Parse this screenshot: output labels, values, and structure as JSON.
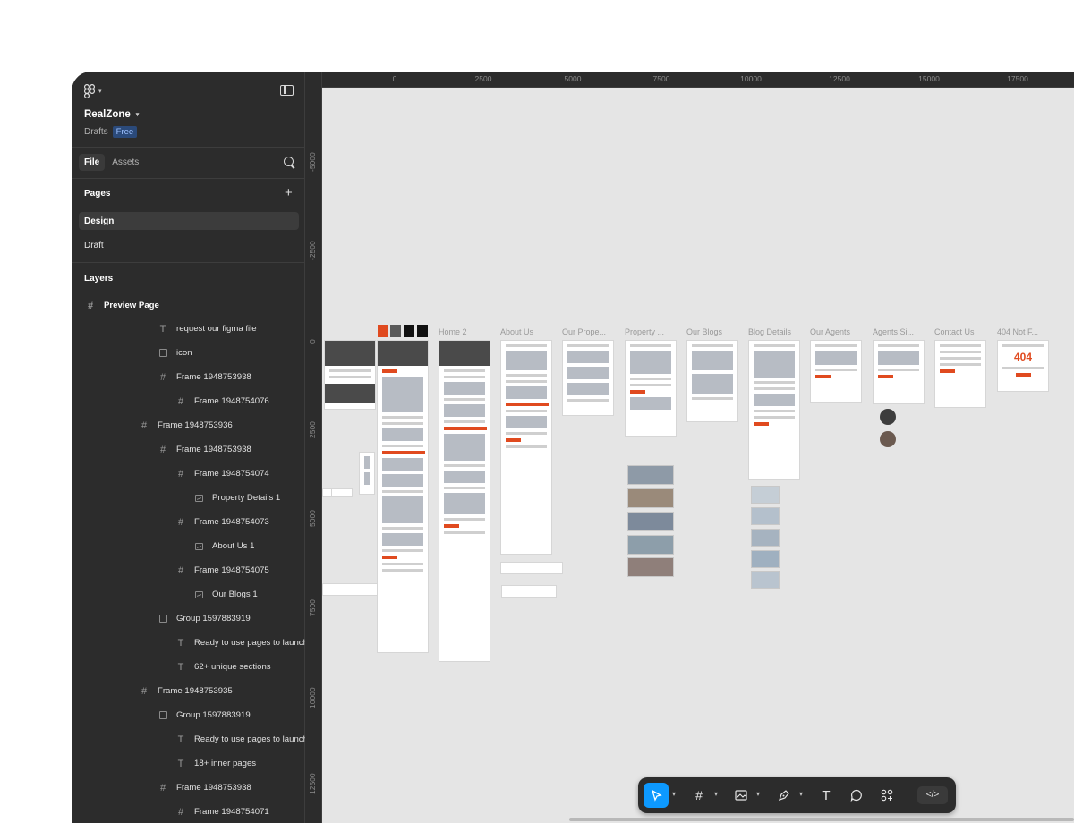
{
  "app": {
    "file_name": "RealZone",
    "location": "Drafts",
    "plan_badge": "Free"
  },
  "sidebar": {
    "tabs": [
      "File",
      "Assets"
    ],
    "pages_title": "Pages",
    "pages": [
      "Design",
      "Draft"
    ],
    "layers_title": "Layers",
    "root_layer": "Preview Page",
    "layers": [
      {
        "name": "request our figma file",
        "type": "text",
        "depth": 4
      },
      {
        "name": "icon",
        "type": "group",
        "depth": 4
      },
      {
        "name": "Frame 1948753938",
        "type": "frame",
        "depth": 4
      },
      {
        "name": "Frame 1948754076",
        "type": "frame",
        "depth": 5
      },
      {
        "name": "Frame 1948753936",
        "type": "frame",
        "depth": 3
      },
      {
        "name": "Frame 1948753938",
        "type": "frame",
        "depth": 4
      },
      {
        "name": "Frame 1948754074",
        "type": "frame",
        "depth": 5
      },
      {
        "name": "Property Details 1",
        "type": "image",
        "depth": 6
      },
      {
        "name": "Frame 1948754073",
        "type": "frame",
        "depth": 5
      },
      {
        "name": "About Us 1",
        "type": "image",
        "depth": 6
      },
      {
        "name": "Frame 1948754075",
        "type": "frame",
        "depth": 5
      },
      {
        "name": "Our Blogs 1",
        "type": "image",
        "depth": 6
      },
      {
        "name": "Group 1597883919",
        "type": "group",
        "depth": 4
      },
      {
        "name": "Ready to use pages to launch",
        "type": "text",
        "depth": 5
      },
      {
        "name": "62+ unique sections",
        "type": "text",
        "depth": 5
      },
      {
        "name": "Frame 1948753935",
        "type": "frame",
        "depth": 3
      },
      {
        "name": "Group 1597883919",
        "type": "group",
        "depth": 4
      },
      {
        "name": "Ready to use pages to launch",
        "type": "text",
        "depth": 5
      },
      {
        "name": "18+ inner pages",
        "type": "text",
        "depth": 5
      },
      {
        "name": "Frame 1948753938",
        "type": "frame",
        "depth": 4
      },
      {
        "name": "Frame 1948754071",
        "type": "frame",
        "depth": 5
      }
    ]
  },
  "canvas": {
    "ruler_top": [
      "0",
      "2500",
      "5000",
      "7500",
      "10000",
      "12500",
      "15000",
      "17500"
    ],
    "ruler_left": [
      "-5000",
      "-2500",
      "0",
      "2500",
      "5000",
      "7500",
      "10000",
      "12500"
    ],
    "frame_titles": [
      "Home 2",
      "About Us",
      "Our Prope...",
      "Property ...",
      "Our Blogs",
      "Blog Details",
      "Our Agents",
      "Agents Si...",
      "Contact Us",
      "404 Not F..."
    ],
    "not_found_text": "404",
    "brand_color": "#e04a1f"
  },
  "toolbar": {
    "tools": [
      "move-tool",
      "frame-tool",
      "image-tool",
      "pen-tool",
      "text-tool",
      "comment-tool",
      "actions-tool",
      "dev-mode-toggle"
    ],
    "active_tool": "move-tool"
  }
}
